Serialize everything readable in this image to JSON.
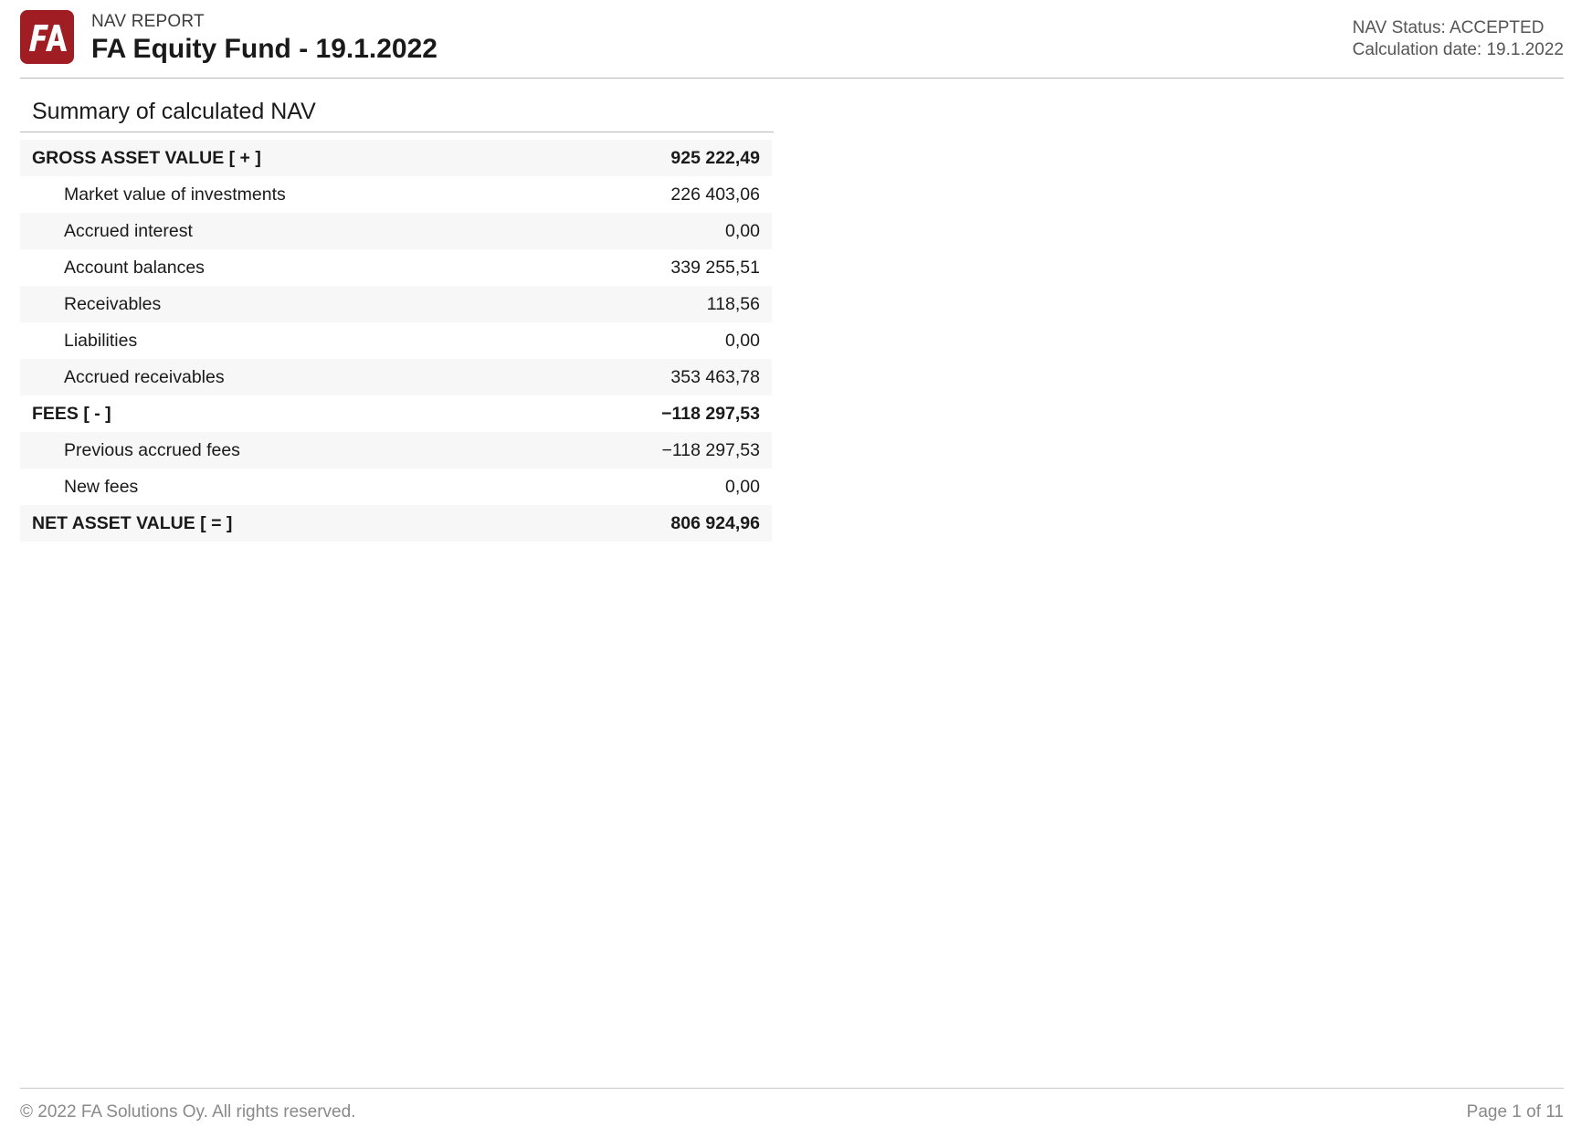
{
  "header": {
    "logo_text": "FA",
    "kicker": "NAV REPORT",
    "title": "FA Equity Fund - 19.1.2022",
    "status": "NAV Status: ACCEPTED",
    "calculation_date": "Calculation date: 19.1.2022"
  },
  "summary": {
    "title": "Summary of calculated NAV",
    "rows": [
      {
        "label": "GROSS ASSET VALUE [ + ]",
        "value": "925 222,49",
        "bold": true,
        "indent": false
      },
      {
        "label": "Market value of investments",
        "value": "226 403,06",
        "bold": false,
        "indent": true
      },
      {
        "label": "Accrued interest",
        "value": "0,00",
        "bold": false,
        "indent": true
      },
      {
        "label": "Account balances",
        "value": "339 255,51",
        "bold": false,
        "indent": true
      },
      {
        "label": "Receivables",
        "value": "118,56",
        "bold": false,
        "indent": true
      },
      {
        "label": "Liabilities",
        "value": "0,00",
        "bold": false,
        "indent": true
      },
      {
        "label": "Accrued receivables",
        "value": "353 463,78",
        "bold": false,
        "indent": true
      },
      {
        "label": "FEES [ - ]",
        "value": "−118 297,53",
        "bold": true,
        "indent": false
      },
      {
        "label": "Previous accrued fees",
        "value": "−118 297,53",
        "bold": false,
        "indent": true
      },
      {
        "label": "New fees",
        "value": "0,00",
        "bold": false,
        "indent": true
      },
      {
        "label": "NET ASSET VALUE [ = ]",
        "value": "806 924,96",
        "bold": true,
        "indent": false
      }
    ]
  },
  "footer": {
    "copyright": "© 2022 FA Solutions Oy. All rights reserved.",
    "page": "Page 1 of 11"
  },
  "colors": {
    "brand": "#9f1d23",
    "rule": "#b8b8b8",
    "row_alt": "#f7f7f7",
    "muted_text": "#8a8a8a"
  }
}
